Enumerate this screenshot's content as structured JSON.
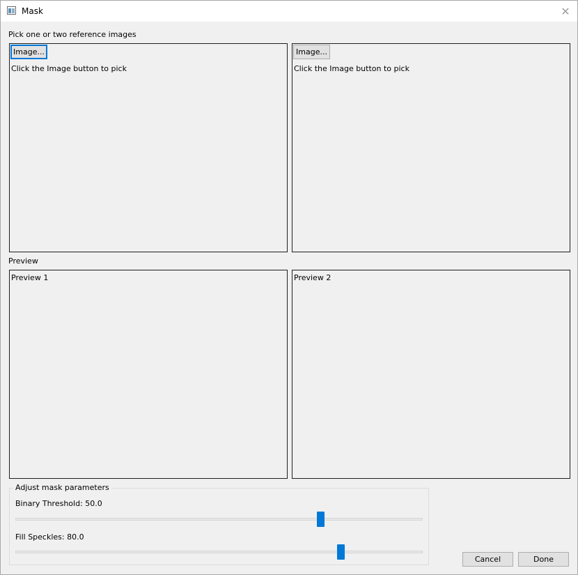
{
  "window": {
    "title": "Mask",
    "close_glyph": "✕"
  },
  "reference": {
    "label": "Pick one or two reference images",
    "panels": [
      {
        "button_label": "Image...",
        "hint": "Click the Image button to pick"
      },
      {
        "button_label": "Image...",
        "hint": "Click the Image button to pick"
      }
    ]
  },
  "preview": {
    "label": "Preview",
    "panels": [
      {
        "label": "Preview 1"
      },
      {
        "label": "Preview 2"
      }
    ]
  },
  "parameters": {
    "title": "Adjust mask parameters",
    "binary_threshold": {
      "label": "Binary Threshold: 50.0",
      "value": 50.0,
      "position_fraction": 0.74
    },
    "fill_speckles": {
      "label": "Fill Speckles: 80.0",
      "value": 80.0,
      "position_fraction": 0.79
    }
  },
  "footer": {
    "cancel_label": "Cancel",
    "done_label": "Done"
  },
  "icons": {
    "app": "app-window-icon",
    "close": "close-icon"
  },
  "colors": {
    "accent": "#0078d7",
    "panel_border": "#1e1e1e",
    "background": "#f0f0f0"
  }
}
